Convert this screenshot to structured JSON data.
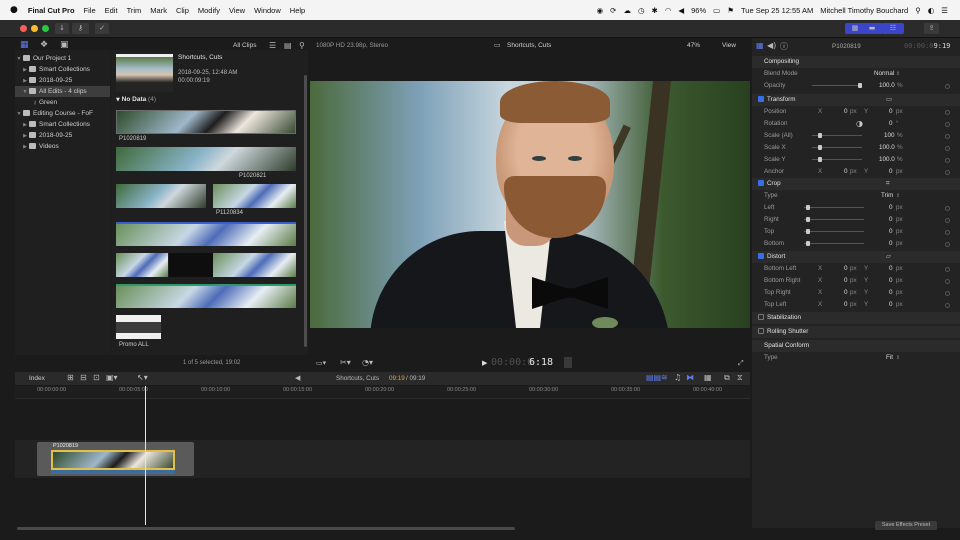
{
  "menubar": {
    "app": "Final Cut Pro",
    "menus": [
      "File",
      "Edit",
      "Trim",
      "Mark",
      "Clip",
      "Modify",
      "View",
      "Window",
      "Help"
    ],
    "battery": "96%",
    "clock": "Tue Sep 25  12:55 AM",
    "user": "Mitchell Timothy Bouchard"
  },
  "browser": {
    "filter": "All Clips",
    "preview_name": "Shortcuts, Cuts",
    "preview_date": "2018-09-25, 12:48 AM",
    "preview_duration": "00:00:09:19",
    "group_label": "No Data",
    "group_count": "(4)",
    "clips": [
      "P1020819",
      "P1020821",
      "P1120834",
      "Promo ALL"
    ],
    "footer": "1 of 5 selected, 19:02"
  },
  "library": {
    "items": [
      {
        "label": "Our Project 1"
      },
      {
        "label": "Smart Collections"
      },
      {
        "label": "2018-09-25"
      },
      {
        "label": "All Edits - 4 clips"
      },
      {
        "label": "Green"
      },
      {
        "label": "Editing Course - FoF"
      },
      {
        "label": "Smart Collections"
      },
      {
        "label": "2018-09-25"
      },
      {
        "label": "Videos"
      }
    ]
  },
  "viewer": {
    "format": "1080P HD 23.98p, Stereo",
    "title": "Shortcuts, Cuts",
    "zoom": "47%",
    "view_menu": "View",
    "timecode": "6:18"
  },
  "inspector": {
    "clip_name": "P1020819",
    "clip_duration": "9:19",
    "compositing": "Compositing",
    "blend_mode_label": "Blend Mode",
    "blend_mode_value": "Normal",
    "opacity_label": "Opacity",
    "opacity_value": "100.0",
    "transform": "Transform",
    "position_label": "Position",
    "rotation_label": "Rotation",
    "scale_all_label": "Scale (All)",
    "scale_x_label": "Scale X",
    "scale_y_label": "Scale Y",
    "anchor_label": "Anchor",
    "crop": "Crop",
    "type_label": "Type",
    "crop_type": "Trim",
    "left_label": "Left",
    "right_label": "Right",
    "top_label": "Top",
    "bottom_label": "Bottom",
    "distort": "Distort",
    "bottom_left": "Bottom Left",
    "bottom_right": "Bottom Right",
    "top_right": "Top Right",
    "top_left": "Top Left",
    "stabilization": "Stabilization",
    "rolling_shutter": "Rolling Shutter",
    "spatial_conform": "Spatial Conform",
    "conform_type": "Fit",
    "zero": "0",
    "px": "px",
    "pct": "%",
    "deg": "°",
    "x": "X",
    "y": "Y",
    "hundred": "100",
    "hundred_dec": "100.0",
    "save_preset": "Save Effects Preset"
  },
  "timeline": {
    "index": "Index",
    "project": "Shortcuts, Cuts",
    "position": "09:19",
    "duration": "/ 09:19",
    "ruler": [
      "00:00:00:00",
      "00:00:05:00",
      "00:00:10:00",
      "00:00:15:00",
      "00:00:20:00",
      "00:00:25:00",
      "00:00:30:00",
      "00:00:35:00",
      "00:00:40:00"
    ],
    "clip_name": "P1020819"
  }
}
